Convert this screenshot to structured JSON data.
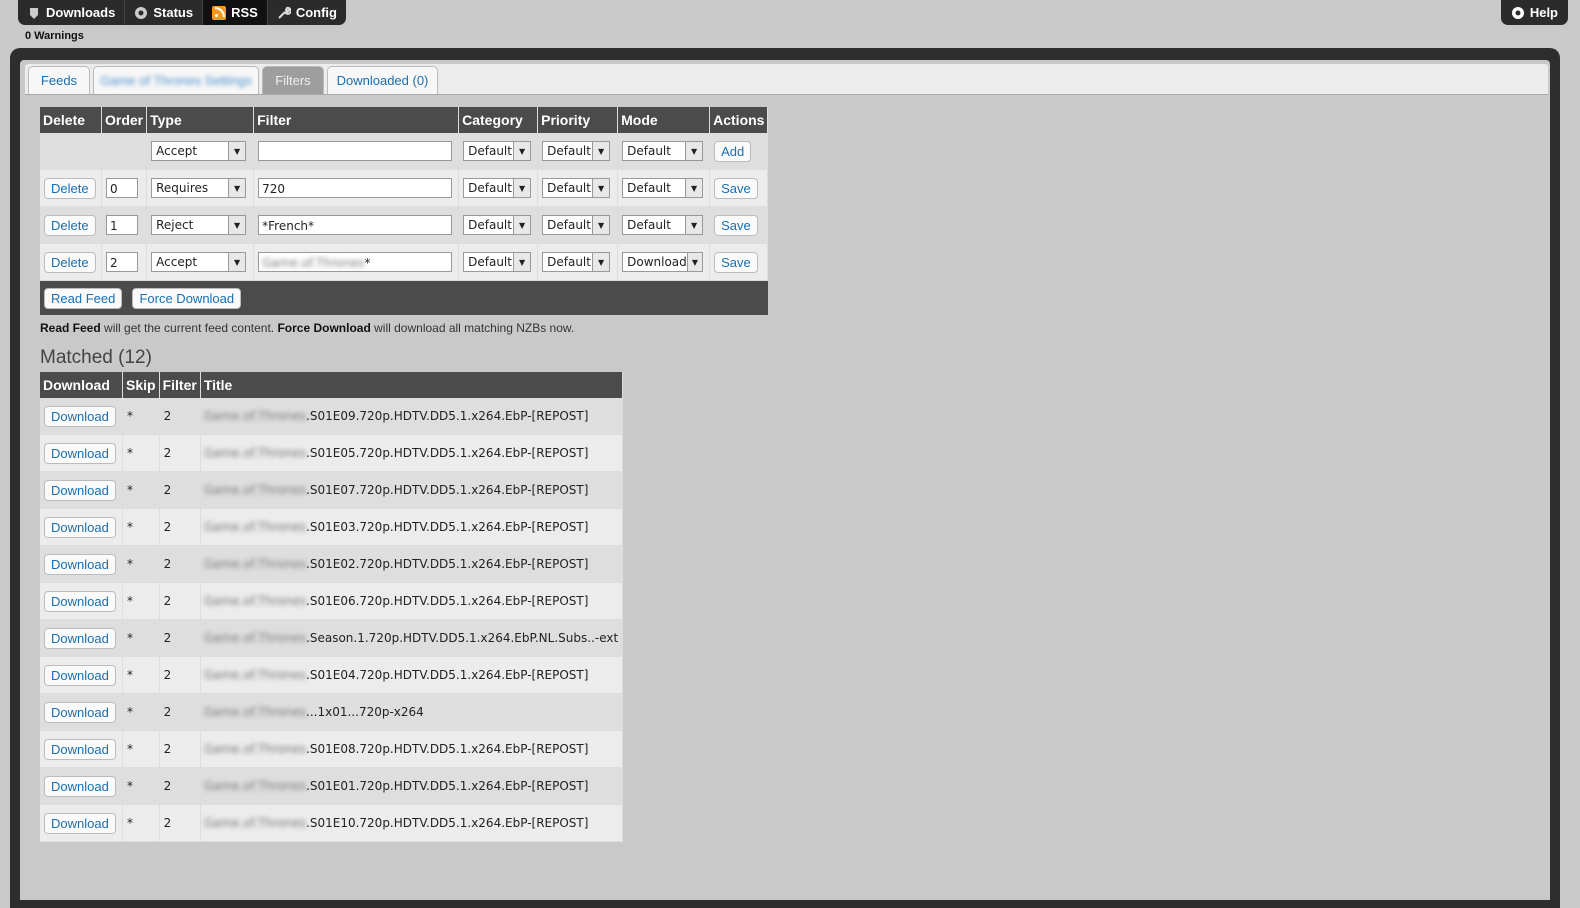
{
  "nav": {
    "items": [
      {
        "label": "Downloads",
        "icon": "downloads-icon"
      },
      {
        "label": "Status",
        "icon": "status-icon"
      },
      {
        "label": "RSS",
        "icon": "rss-icon"
      },
      {
        "label": "Config",
        "icon": "wrench-icon"
      }
    ],
    "active": "RSS",
    "help_label": "Help"
  },
  "warnings": "0 Warnings",
  "tabs": [
    {
      "label": "Feeds",
      "state": "normal"
    },
    {
      "label": "Game of Thrones Settings",
      "state": "blurred"
    },
    {
      "label": "Filters",
      "state": "active"
    },
    {
      "label": "Downloaded (0)",
      "state": "normal"
    }
  ],
  "filters": {
    "headers": [
      "Delete",
      "Order",
      "Type",
      "Filter",
      "Category",
      "Priority",
      "Mode",
      "Actions"
    ],
    "new_row": {
      "type": "Accept",
      "filter": "",
      "category": "Default",
      "priority": "Default",
      "mode": "Default",
      "action": "Add"
    },
    "rows": [
      {
        "delete": "Delete",
        "order": "0",
        "type": "Requires",
        "filter": "720",
        "filter_blur": "",
        "category": "Default",
        "priority": "Default",
        "mode": "Default",
        "action": "Save"
      },
      {
        "delete": "Delete",
        "order": "1",
        "type": "Reject",
        "filter": "*French*",
        "filter_blur": "",
        "category": "Default",
        "priority": "Default",
        "mode": "Default",
        "action": "Save"
      },
      {
        "delete": "Delete",
        "order": "2",
        "type": "Accept",
        "filter": "*",
        "filter_blur": "Game.of.Thrones",
        "category": "Default",
        "priority": "Default",
        "mode": "Download",
        "action": "Save"
      }
    ],
    "read_feed": "Read Feed",
    "force_download": "Force Download"
  },
  "description": {
    "read_feed": "Read Feed",
    "mid": " will get the current feed content. ",
    "force_download": "Force Download",
    "end": " will download all matching NZBs now."
  },
  "matched": {
    "title": "Matched (12)",
    "headers": [
      "Download",
      "Skip",
      "Filter",
      "Title"
    ],
    "download_label": "Download",
    "rows": [
      {
        "skip": "*",
        "filter": "2",
        "blur": "Game.of.Thrones",
        "title": ".S01E09.720p.HDTV.DD5.1.x264.EbP-[REPOST]"
      },
      {
        "skip": "*",
        "filter": "2",
        "blur": "Game.of.Thrones",
        "title": ".S01E05.720p.HDTV.DD5.1.x264.EbP-[REPOST]"
      },
      {
        "skip": "*",
        "filter": "2",
        "blur": "Game.of.Thrones",
        "title": ".S01E07.720p.HDTV.DD5.1.x264.EbP-[REPOST]"
      },
      {
        "skip": "*",
        "filter": "2",
        "blur": "Game.of.Thrones",
        "title": ".S01E03.720p.HDTV.DD5.1.x264.EbP-[REPOST]"
      },
      {
        "skip": "*",
        "filter": "2",
        "blur": "Game.of.Thrones",
        "title": ".S01E02.720p.HDTV.DD5.1.x264.EbP-[REPOST]"
      },
      {
        "skip": "*",
        "filter": "2",
        "blur": "Game.of.Thrones",
        "title": ".S01E06.720p.HDTV.DD5.1.x264.EbP-[REPOST]"
      },
      {
        "skip": "*",
        "filter": "2",
        "blur": "Game.of.Thrones",
        "title": ".Season.1.720p.HDTV.DD5.1.x264.EbP.NL.Subs..-ext"
      },
      {
        "skip": "*",
        "filter": "2",
        "blur": "Game.of.Thrones",
        "title": ".S01E04.720p.HDTV.DD5.1.x264.EbP-[REPOST]"
      },
      {
        "skip": "*",
        "filter": "2",
        "blur": "Game.of.Thrones",
        "title": "...1x01...720p-x264"
      },
      {
        "skip": "*",
        "filter": "2",
        "blur": "Game.of.Thrones",
        "title": ".S01E08.720p.HDTV.DD5.1.x264.EbP-[REPOST]"
      },
      {
        "skip": "*",
        "filter": "2",
        "blur": "Game.of.Thrones",
        "title": ".S01E01.720p.HDTV.DD5.1.x264.EbP-[REPOST]"
      },
      {
        "skip": "*",
        "filter": "2",
        "blur": "Game.of.Thrones",
        "title": ".S01E10.720p.HDTV.DD5.1.x264.EbP-[REPOST]"
      }
    ]
  }
}
